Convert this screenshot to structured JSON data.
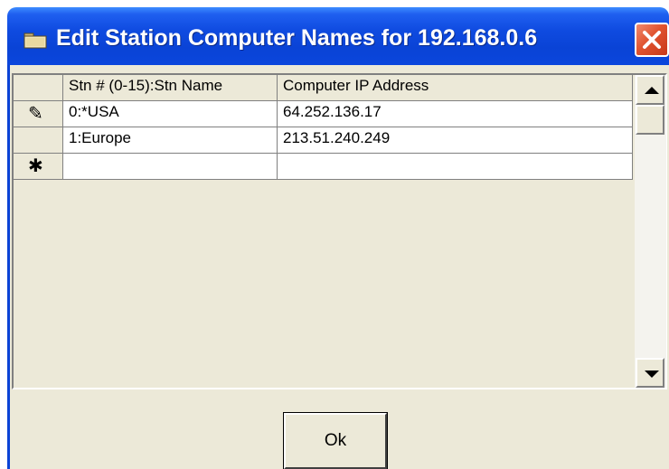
{
  "window": {
    "title": "Edit Station Computer Names for 192.168.0.6"
  },
  "grid": {
    "headers": [
      "Stn # (0-15):Stn Name",
      "Computer IP Address"
    ],
    "rows": [
      {
        "selector": "✎",
        "name": "0:*USA",
        "ip": "64.252.136.17"
      },
      {
        "selector": "",
        "name": "1:Europe",
        "ip": "213.51.240.249"
      },
      {
        "selector": "✱",
        "name": "",
        "ip": ""
      }
    ]
  },
  "buttons": {
    "ok": "Ok"
  },
  "icons": {
    "title": "folder-icon",
    "close": "close-icon",
    "scroll_up": "arrow-up-icon",
    "scroll_down": "arrow-down-icon"
  },
  "colors": {
    "titlebar": "#0a43d6",
    "close": "#e0532f",
    "face": "#ece9d8"
  }
}
